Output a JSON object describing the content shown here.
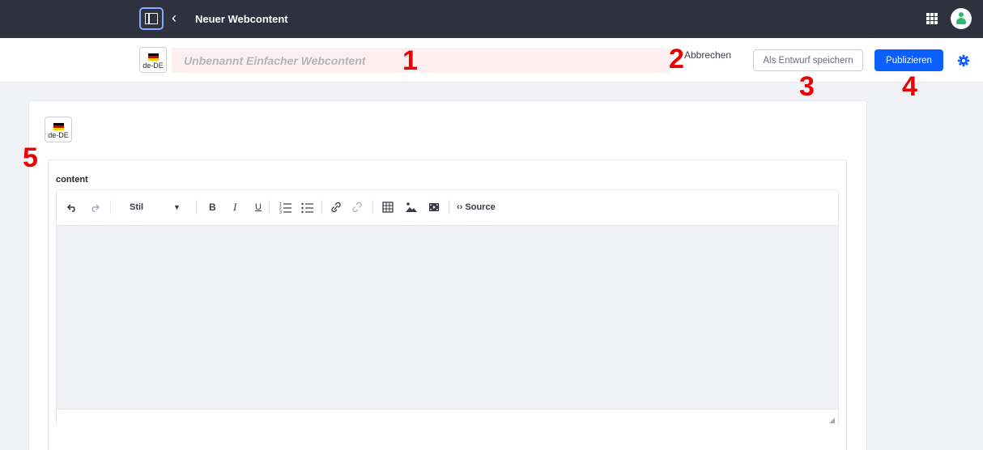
{
  "topbar": {
    "title": "Neuer Webcontent"
  },
  "header": {
    "language_label": "de-DE",
    "title_placeholder": "Unbenannt Einfacher Webcontent",
    "cancel_label": "Abbrechen",
    "draft_label": "Als Entwurf speichern",
    "publish_label": "Publizieren"
  },
  "content": {
    "language_label": "de-DE",
    "field_label": "content",
    "toolbar": {
      "style_label": "Stil",
      "bold": "B",
      "italic": "I",
      "underline": "U",
      "source_label": "Source"
    }
  },
  "annotations": [
    "1",
    "2",
    "3",
    "4",
    "5"
  ],
  "colors": {
    "topbar": "#30313f",
    "primary": "#0b5fff",
    "title_input_bg": "#fdefef",
    "annotation": "#ee0000",
    "avatar": "#2fb86b"
  },
  "icons": [
    "sidebar-toggle-icon",
    "chevron-left-icon",
    "apps-grid-icon",
    "user-avatar-icon",
    "flag-de-icon",
    "gear-icon",
    "undo-icon",
    "redo-icon",
    "caret-down-icon",
    "numbered-list-icon",
    "bulleted-list-icon",
    "link-icon",
    "unlink-icon",
    "table-icon",
    "image-icon",
    "video-icon",
    "source-code-icon",
    "resize-handle-icon"
  ]
}
